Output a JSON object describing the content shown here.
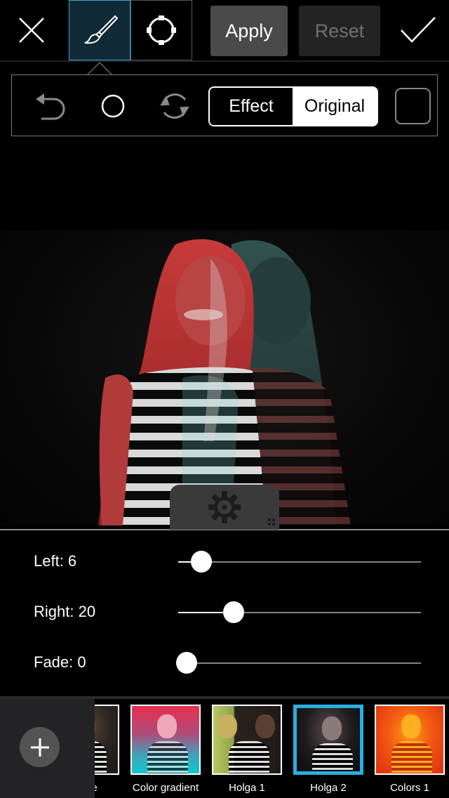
{
  "toolbar": {
    "close_icon": "close-icon",
    "brush_icon": "brush-icon",
    "shape_icon": "circle-handles-icon",
    "apply_label": "Apply",
    "reset_label": "Reset",
    "confirm_icon": "checkmark-icon",
    "active_tool": "brush"
  },
  "subtoolbar": {
    "undo_icon": "undo-icon",
    "circle_icon": "brush-size-circle-icon",
    "refresh_icon": "refresh-icon",
    "segments": [
      {
        "label": "Effect",
        "selected": false
      },
      {
        "label": "Original",
        "selected": true
      }
    ],
    "square_icon": "square-icon"
  },
  "canvas": {
    "settings_icon": "gear-icon"
  },
  "sliders": [
    {
      "label": "Left: 6",
      "name": "Left",
      "value": 6,
      "fraction": 0.095
    },
    {
      "label": "Right: 20",
      "name": "Right",
      "value": 20,
      "fraction": 0.227
    },
    {
      "label": "Fade: 0",
      "name": "Fade",
      "value": 0,
      "fraction": 0.035
    }
  ],
  "effects": {
    "add_icon": "plus-icon",
    "items": [
      {
        "label": "Mone",
        "visible_label": "ne",
        "selected": false
      },
      {
        "label": "Color gradient",
        "selected": false
      },
      {
        "label": "Holga 1",
        "selected": false
      },
      {
        "label": "Holga 2",
        "selected": true
      },
      {
        "label": "Colors 1",
        "selected": false
      }
    ]
  },
  "colors": {
    "accent": "#2aaee0",
    "active_tool_bg": "#102a38",
    "apply_bg": "#4a4a4a",
    "reset_bg": "#232323"
  }
}
